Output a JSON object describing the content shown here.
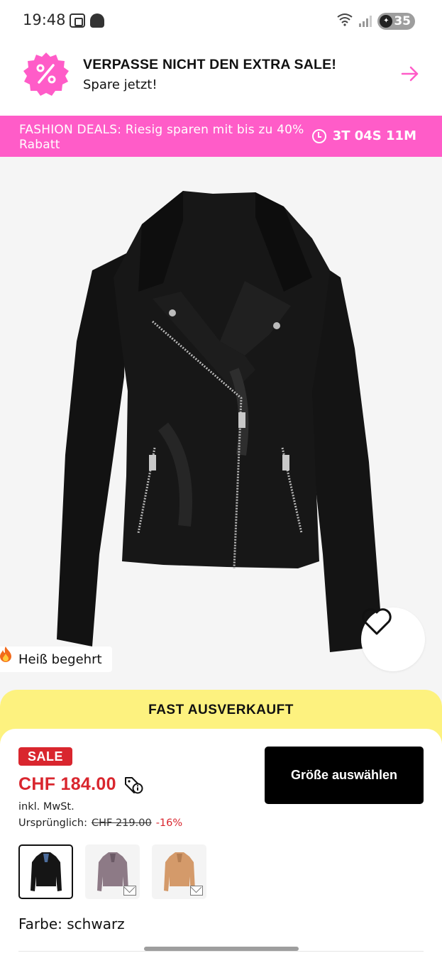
{
  "status_bar": {
    "time": "19:48",
    "battery": "35",
    "icons": [
      "screenshot-icon",
      "snapchat-icon",
      "wifi-icon",
      "signal-icon",
      "battery-icon"
    ]
  },
  "promo": {
    "title": "VERPASSE NICHT DEN EXTRA SALE!",
    "subtitle": "Spare jetzt!",
    "badge_symbol": "%",
    "accent_color": "#ff5cc8"
  },
  "deals": {
    "text": "FASHION DEALS: Riesig sparen mit bis zu 40% Rabatt",
    "timer": "3T 04S 11M",
    "background": "#ff5cc8"
  },
  "product": {
    "hot_label": "Heiß begehrt",
    "sold_out_notice": "FAST AUSVERKAUFT",
    "sale_badge": "SALE",
    "price": "CHF 184.00",
    "vat_note": "inkl. MwSt.",
    "original_label": "Ursprünglich:",
    "original_price": "CHF 219.00",
    "discount": "-16%",
    "size_button": "Größe auswählen",
    "color_label": "Farbe: schwarz",
    "price_color": "#d9262e",
    "variants": [
      {
        "color": "schwarz",
        "selected": true
      },
      {
        "color": "lila",
        "selected": false
      },
      {
        "color": "cognac",
        "selected": false
      }
    ]
  }
}
